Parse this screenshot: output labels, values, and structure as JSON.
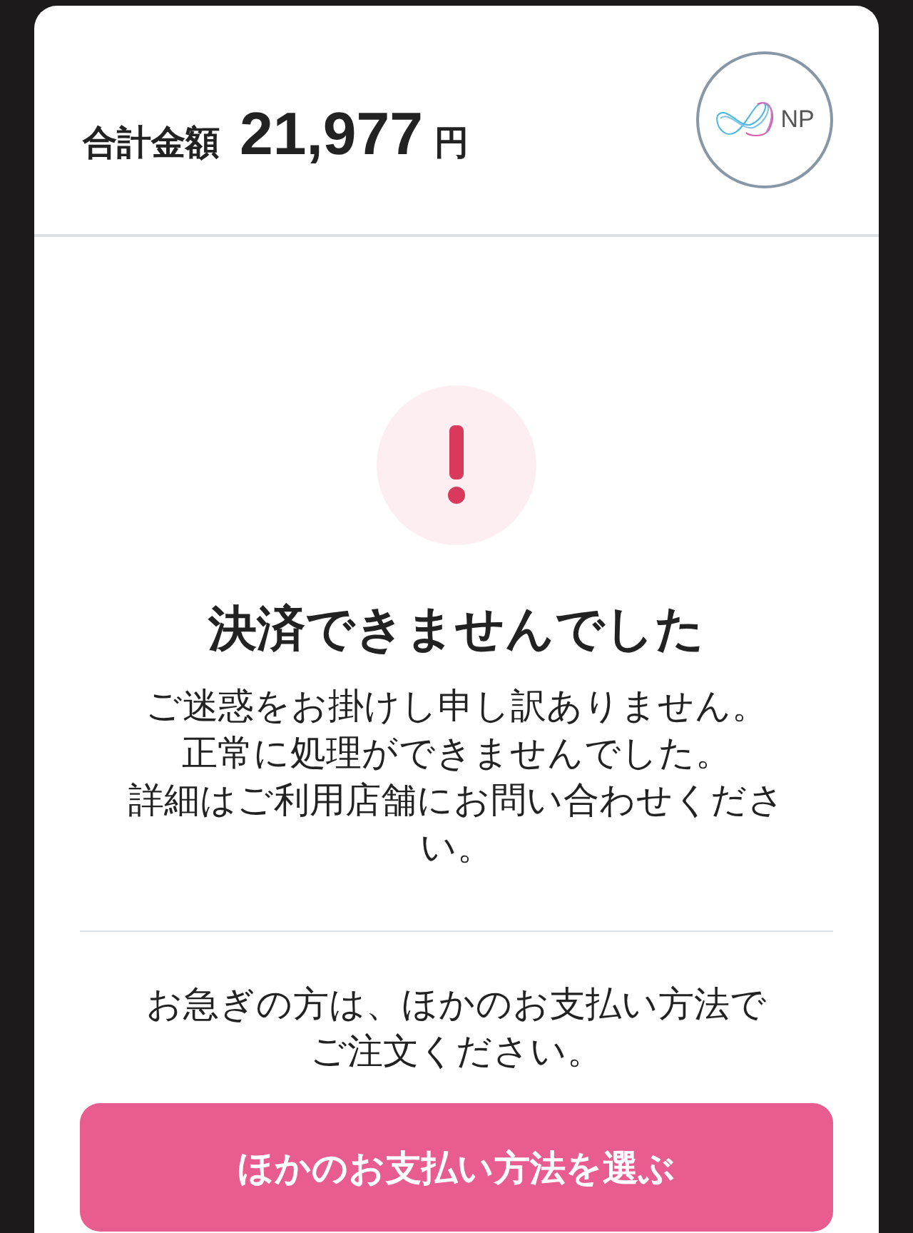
{
  "header": {
    "total_label": "合計金額",
    "amount": "21,977",
    "currency": "円",
    "logo_text": "NP"
  },
  "error": {
    "title": "決済できませんでした",
    "message_lines": [
      "ご迷惑をお掛けし申し訳ありません。",
      "正常に処理ができませんでした。",
      "詳細はご利用店舗にお問い合わせください。"
    ]
  },
  "notice_lines": [
    "お急ぎの方は、ほかのお支払い方法で",
    "ご注文ください。"
  ],
  "button": {
    "label": "ほかのお支払い方法を選ぶ"
  }
}
